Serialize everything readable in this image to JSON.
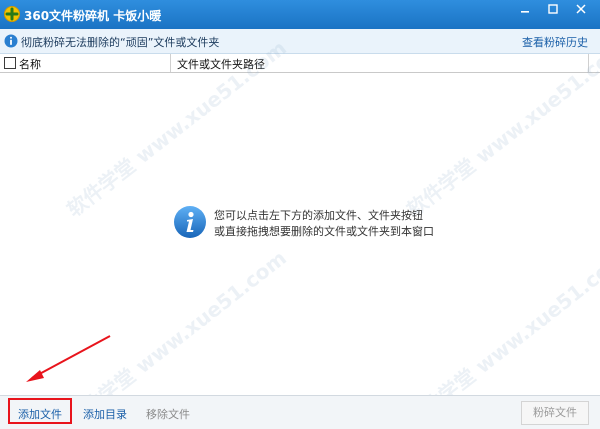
{
  "window": {
    "title": "360文件粉碎机  卡饭小暖"
  },
  "infobar": {
    "text": "彻底粉碎无法删除的“顽固”文件或文件夹",
    "history_link": "查看粉碎历史"
  },
  "table": {
    "columns": [
      "名称",
      "文件或文件夹路径"
    ]
  },
  "hint": {
    "line1": "您可以点击左下方的添加文件、文件夹按钮",
    "line2": "或直接拖拽想要删除的文件或文件夹到本窗口"
  },
  "footer": {
    "add_file": "添加文件",
    "add_dir": "添加目录",
    "remove_file": "移除文件",
    "shred_button": "粉碎文件"
  },
  "watermark": "软件学堂 www.xue51.com",
  "colors": {
    "accent": "#1a73c4",
    "highlight": "#e8141c"
  }
}
